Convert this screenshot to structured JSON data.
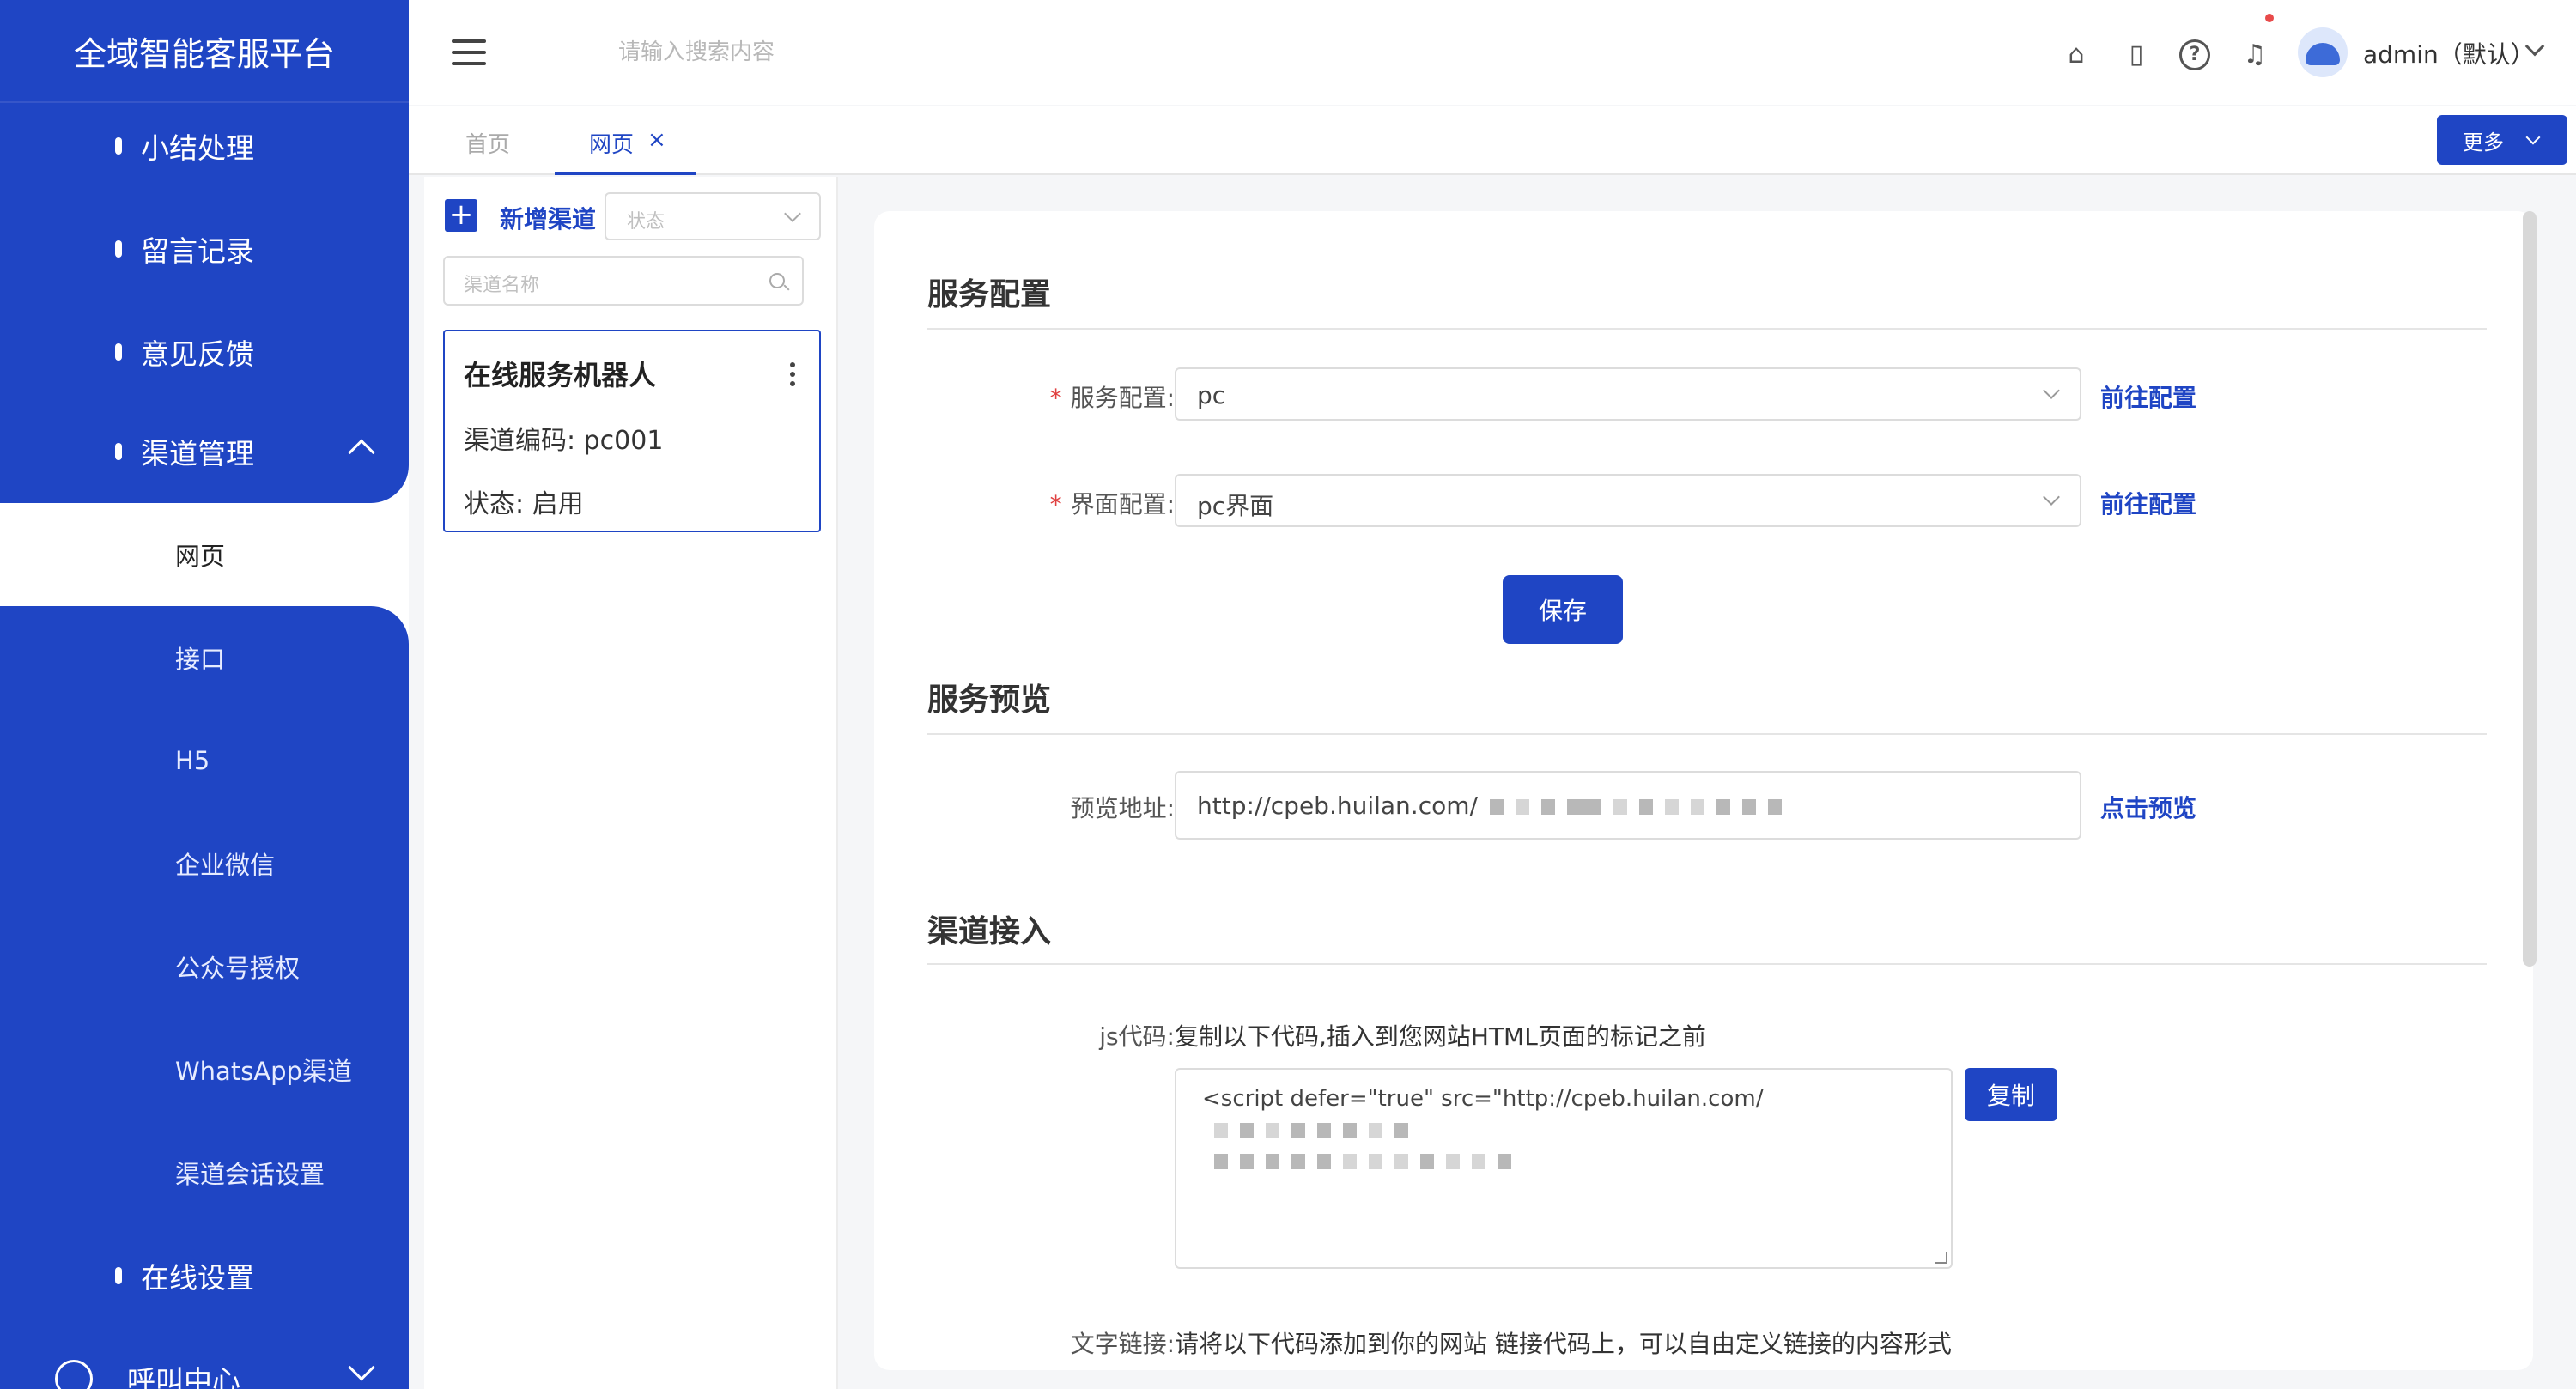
{
  "sidebar": {
    "brand": "全域智能客服平台",
    "items": [
      {
        "label": "小结处理"
      },
      {
        "label": "留言记录"
      },
      {
        "label": "意见反馈"
      },
      {
        "label": "渠道管理"
      }
    ],
    "sub_items": [
      {
        "label": "网页"
      },
      {
        "label": "接口"
      },
      {
        "label": "H5"
      },
      {
        "label": "企业微信"
      },
      {
        "label": "公众号授权"
      },
      {
        "label": "WhatsApp渠道"
      },
      {
        "label": "渠道会话设置"
      }
    ],
    "online_settings": "在线设置",
    "call_center": "呼叫中心"
  },
  "header": {
    "search_placeholder": "请输入搜索内容",
    "username": "admin（默认）",
    "icons": [
      "robot-icon",
      "book-icon",
      "help-icon",
      "bell-icon"
    ]
  },
  "tabs": {
    "home": "首页",
    "web": "网页",
    "close": "×",
    "more": "更多"
  },
  "channel_list": {
    "add_label": "新增渠道",
    "status_placeholder": "状态",
    "name_placeholder": "渠道名称",
    "card": {
      "title": "在线服务机器人",
      "code": "渠道编码: pc001",
      "status": "状态: 启用"
    }
  },
  "config": {
    "service_section": "服务配置",
    "service_label": "服务配置:",
    "service_value": "pc",
    "ui_label": "界面配置:",
    "ui_value": "pc界面",
    "goto": "前往配置",
    "save": "保存",
    "preview_section": "服务预览",
    "preview_label": "预览地址:",
    "preview_url": "http://cpeb.huilan.com/",
    "preview_link": "点击预览",
    "access_section": "渠道接入",
    "js_label": "js代码:",
    "js_desc": "复制以下代码,插入到您网站HTML页面的标记之前",
    "js_code": "<script defer=\"true\" src=\"http://cpeb.huilan.com/",
    "copy": "复制",
    "text_link_label": "文字链接:",
    "text_link_desc": "请将以下代码添加到你的网站 链接代码上，可以自由定义链接的内容形式"
  },
  "colors": {
    "primary": "#1f45c4",
    "required": "#e04040"
  }
}
